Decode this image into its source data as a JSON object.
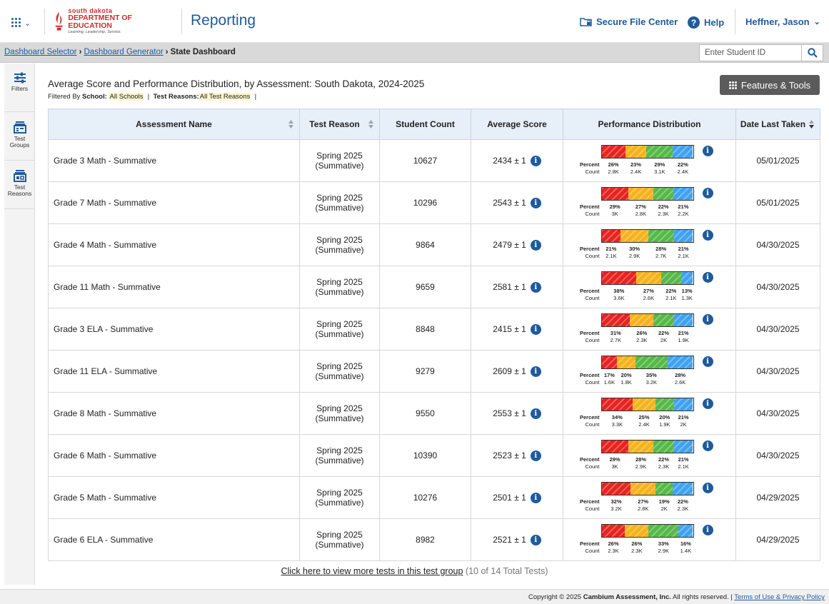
{
  "header": {
    "logo": {
      "line1": "south dakota",
      "line2": "DEPARTMENT OF EDUCATION",
      "tagline": "Learning. Leadership. Service."
    },
    "app_title": "Reporting",
    "secure_file_center": "Secure File Center",
    "help": "Help",
    "user": "Heffner, Jason"
  },
  "breadcrumb": {
    "items": [
      "Dashboard Selector",
      "Dashboard Generator"
    ],
    "current": "State Dashboard"
  },
  "student_search": {
    "placeholder": "Enter Student ID"
  },
  "sidebar": {
    "items": [
      {
        "label": "Filters"
      },
      {
        "label": "Test Groups"
      },
      {
        "label": "Test Reasons"
      }
    ]
  },
  "main": {
    "title": "Average Score and Performance Distribution, by Assessment: South Dakota, 2024-2025",
    "filter_prefix": "Filtered By",
    "filter_school_label": "School:",
    "filter_school_value": "All Schools",
    "filter_reason_label": "Test Reasons:",
    "filter_reason_value": "All Test Reasons",
    "features_button": "Features & Tools"
  },
  "table": {
    "headers": {
      "name": "Assessment Name",
      "reason": "Test Reason",
      "count": "Student Count",
      "avg": "Average Score",
      "perf": "Performance Distribution",
      "date": "Date Last Taken"
    },
    "perf_labels": {
      "percent": "Percent",
      "count": "Count"
    },
    "colors": [
      "#e8231f",
      "#f5b21b",
      "#56b947",
      "#3fa2f0"
    ],
    "rows": [
      {
        "name": "Grade 3 Math - Summative",
        "reason_1": "Spring 2025",
        "reason_2": "(Summative)",
        "count": "10627",
        "avg": "2434 ± 1",
        "pct": [
          26,
          23,
          29,
          22
        ],
        "pct_labels": [
          "26%",
          "23%",
          "29%",
          "22%"
        ],
        "cnt_labels": [
          "2.8K",
          "2.4K",
          "3.1K",
          "2.4K"
        ],
        "date": "05/01/2025"
      },
      {
        "name": "Grade 7 Math - Summative",
        "reason_1": "Spring 2025",
        "reason_2": "(Summative)",
        "count": "10296",
        "avg": "2543 ± 1",
        "pct": [
          29,
          27,
          22,
          21
        ],
        "pct_labels": [
          "29%",
          "27%",
          "22%",
          "21%"
        ],
        "cnt_labels": [
          "3K",
          "2.8K",
          "2.3K",
          "2.2K"
        ],
        "date": "05/01/2025"
      },
      {
        "name": "Grade 4 Math - Summative",
        "reason_1": "Spring 2025",
        "reason_2": "(Summative)",
        "count": "9864",
        "avg": "2479 ± 1",
        "pct": [
          21,
          30,
          28,
          21
        ],
        "pct_labels": [
          "21%",
          "30%",
          "28%",
          "21%"
        ],
        "cnt_labels": [
          "2.1K",
          "2.9K",
          "2.7K",
          "2.1K"
        ],
        "date": "04/30/2025"
      },
      {
        "name": "Grade 11 Math - Summative",
        "reason_1": "Spring 2025",
        "reason_2": "(Summative)",
        "count": "9659",
        "avg": "2581 ± 1",
        "pct": [
          38,
          27,
          22,
          13
        ],
        "pct_labels": [
          "38%",
          "27%",
          "22%",
          "13%"
        ],
        "cnt_labels": [
          "3.6K",
          "2.6K",
          "2.1K",
          "1.3K"
        ],
        "date": "04/30/2025"
      },
      {
        "name": "Grade 3 ELA - Summative",
        "reason_1": "Spring 2025",
        "reason_2": "(Summative)",
        "count": "8848",
        "avg": "2415 ± 1",
        "pct": [
          31,
          26,
          22,
          21
        ],
        "pct_labels": [
          "31%",
          "26%",
          "22%",
          "21%"
        ],
        "cnt_labels": [
          "2.7K",
          "2.3K",
          "2K",
          "1.9K"
        ],
        "date": "04/30/2025"
      },
      {
        "name": "Grade 11 ELA - Summative",
        "reason_1": "Spring 2025",
        "reason_2": "(Summative)",
        "count": "9279",
        "avg": "2609 ± 1",
        "pct": [
          17,
          20,
          35,
          28
        ],
        "pct_labels": [
          "17%",
          "20%",
          "35%",
          "28%"
        ],
        "cnt_labels": [
          "1.6K",
          "1.8K",
          "3.2K",
          "2.6K"
        ],
        "date": "04/30/2025"
      },
      {
        "name": "Grade 8 Math - Summative",
        "reason_1": "Spring 2025",
        "reason_2": "(Summative)",
        "count": "9550",
        "avg": "2553 ± 1",
        "pct": [
          34,
          25,
          20,
          21
        ],
        "pct_labels": [
          "34%",
          "25%",
          "20%",
          "21%"
        ],
        "cnt_labels": [
          "3.3K",
          "2.4K",
          "1.9K",
          "2K"
        ],
        "date": "04/30/2025"
      },
      {
        "name": "Grade 6 Math - Summative",
        "reason_1": "Spring 2025",
        "reason_2": "(Summative)",
        "count": "10390",
        "avg": "2523 ± 1",
        "pct": [
          29,
          28,
          22,
          21
        ],
        "pct_labels": [
          "29%",
          "28%",
          "22%",
          "21%"
        ],
        "cnt_labels": [
          "3K",
          "2.9K",
          "2.3K",
          "2.1K"
        ],
        "date": "04/30/2025"
      },
      {
        "name": "Grade 5 Math - Summative",
        "reason_1": "Spring 2025",
        "reason_2": "(Summative)",
        "count": "10276",
        "avg": "2501 ± 1",
        "pct": [
          32,
          27,
          19,
          22
        ],
        "pct_labels": [
          "32%",
          "27%",
          "19%",
          "22%"
        ],
        "cnt_labels": [
          "3.2K",
          "2.8K",
          "2K",
          "2.3K"
        ],
        "date": "04/29/2025"
      },
      {
        "name": "Grade 6 ELA - Summative",
        "reason_1": "Spring 2025",
        "reason_2": "(Summative)",
        "count": "8982",
        "avg": "2521 ± 1",
        "pct": [
          26,
          26,
          33,
          16
        ],
        "pct_labels": [
          "26%",
          "26%",
          "33%",
          "16%"
        ],
        "cnt_labels": [
          "2.3K",
          "2.3K",
          "2.9K",
          "1.4K"
        ],
        "date": "04/29/2025"
      }
    ]
  },
  "more_tests": {
    "link": "Click here to view more tests in this test group",
    "suffix": "(10 of 14 Total Tests)"
  },
  "footer": {
    "copyright_prefix": "Copyright © 2025",
    "company": "Cambium Assessment, Inc.",
    "rights": "All rights reserved. |",
    "terms": "Terms of Use & Privacy Policy"
  }
}
